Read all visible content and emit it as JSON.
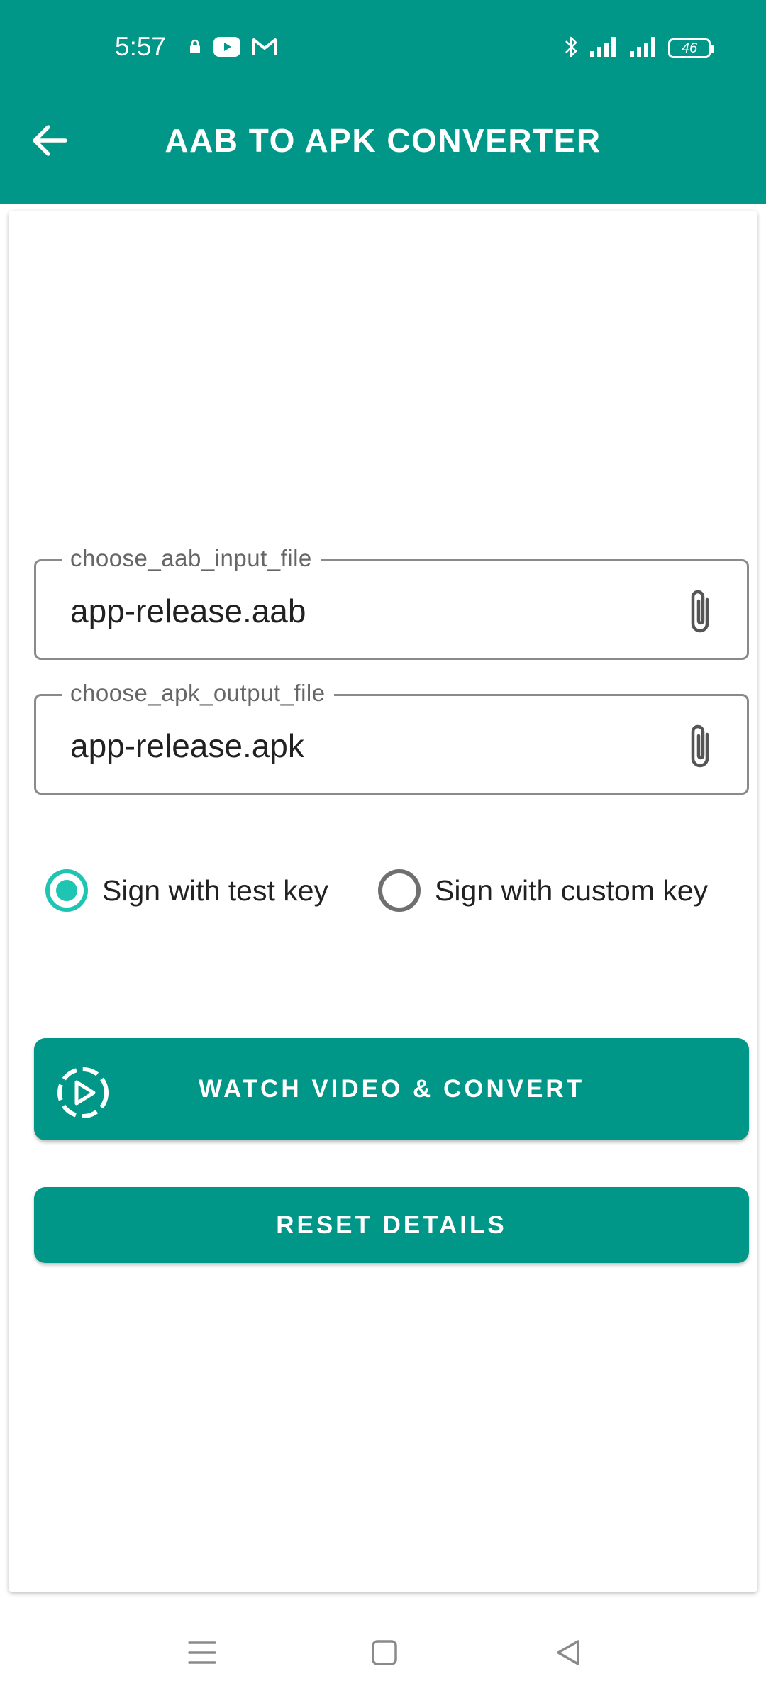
{
  "status_bar": {
    "time": "5:57",
    "battery_level": "46",
    "icons": [
      "notification-lock-icon",
      "youtube-icon",
      "gmail-icon",
      "bluetooth-icon",
      "signal-icon",
      "signal-icon",
      "battery-icon"
    ]
  },
  "app_bar": {
    "title": "AAB TO APK CONVERTER",
    "back_icon": "arrow-left-icon"
  },
  "form": {
    "input_field": {
      "label": "choose_aab_input_file",
      "value": "app-release.aab",
      "icon": "paperclip-icon"
    },
    "output_field": {
      "label": "choose_apk_output_file",
      "value": "app-release.apk",
      "icon": "paperclip-icon"
    },
    "signing_options": [
      {
        "label": "Sign with test key",
        "selected": true
      },
      {
        "label": "Sign with custom key",
        "selected": false
      }
    ],
    "convert_button": {
      "label": "WATCH VIDEO & CONVERT",
      "icon": "play-circle-dashed-icon"
    },
    "reset_button": {
      "label": "RESET DETAILS"
    }
  },
  "colors": {
    "primary": "#009688",
    "accent": "#1ec5b3",
    "text": "#212121",
    "label": "#666666"
  },
  "nav_bar": {
    "icons": [
      "menu-icon",
      "home-icon",
      "back-triangle-icon"
    ]
  }
}
